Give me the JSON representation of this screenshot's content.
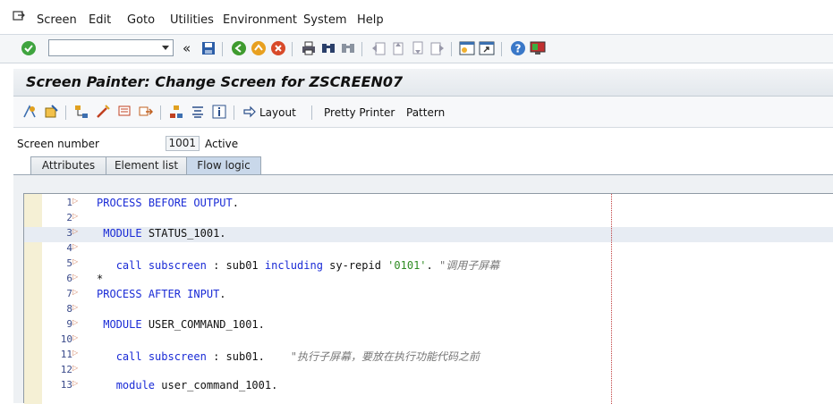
{
  "menubar": {
    "items": [
      "Screen",
      "Edit",
      "Goto",
      "Utilities",
      "Environment",
      "System",
      "Help"
    ]
  },
  "toolbar": {
    "command_field_value": "",
    "back_glyph": "«"
  },
  "title": "Screen Painter: Change Screen for ZSCREEN07",
  "app_toolbar": {
    "layout_label": "Layout",
    "pretty_printer_label": "Pretty Printer",
    "pattern_label": "Pattern"
  },
  "screen": {
    "number_label": "Screen number",
    "number_value": "1001",
    "status": "Active"
  },
  "tabs": [
    "Attributes",
    "Element list",
    "Flow logic"
  ],
  "active_tab": "Flow logic",
  "code_lines": [
    {
      "n": "1",
      "text": "PROCESS BEFORE OUTPUT."
    },
    {
      "n": "2",
      "text": ""
    },
    {
      "n": "3",
      "text": " MODULE STATUS_1001."
    },
    {
      "n": "4",
      "text": ""
    },
    {
      "n": "5",
      "text": "   call subscreen : sub01 including sy-repid '0101'. \"调用子屏幕"
    },
    {
      "n": "6",
      "text": "*"
    },
    {
      "n": "7",
      "text": "PROCESS AFTER INPUT."
    },
    {
      "n": "8",
      "text": ""
    },
    {
      "n": "9",
      "text": " MODULE USER_COMMAND_1001."
    },
    {
      "n": "10",
      "text": ""
    },
    {
      "n": "11",
      "text": "   call subscreen : sub01.    \"执行子屏幕，要放在执行功能代码之前"
    },
    {
      "n": "12",
      "text": ""
    },
    {
      "n": "13",
      "text": "   module user_command_1001."
    }
  ],
  "highlighted_line": "3",
  "colors": {
    "keyword": "#1a2bd6",
    "string": "#2e8b22",
    "comment": "#777777",
    "active_tab": "#c9d8ea"
  },
  "icons": [
    "enter-icon",
    "save-icon",
    "back-icon",
    "exit-icon",
    "cancel-icon",
    "print-icon",
    "find-icon",
    "find-next-icon",
    "first-page-icon",
    "previous-page-icon",
    "next-page-icon",
    "last-page-icon",
    "new-session-icon",
    "shortcut-icon",
    "help-icon",
    "customize-layout-icon"
  ]
}
